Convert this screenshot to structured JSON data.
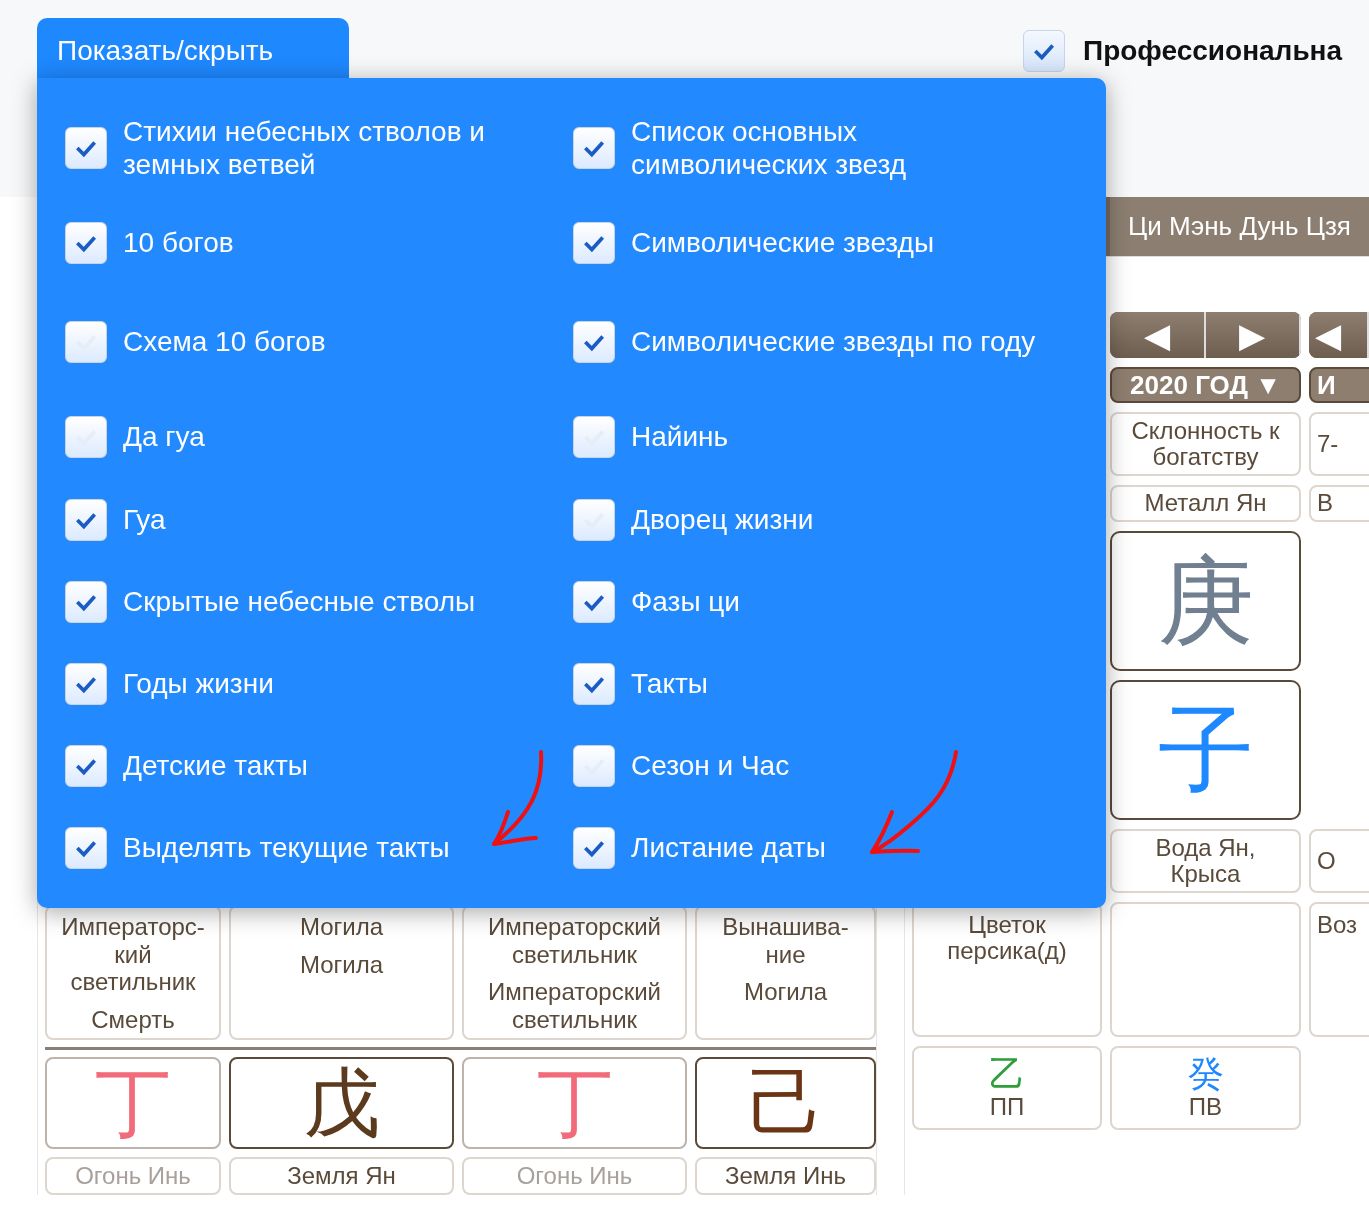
{
  "toggle_button": {
    "label": "Показать/скрыть",
    "expanded": true
  },
  "professional_mode": {
    "label": "Профессиональна",
    "checked": true
  },
  "options": [
    {
      "label": "Стихии небесных стволов и земных ветвей",
      "checked": true
    },
    {
      "label": "Список основных символических звезд",
      "checked": true
    },
    {
      "label": "10 богов",
      "checked": true
    },
    {
      "label": "Символические звезды",
      "checked": true
    },
    {
      "label": "Схема 10 богов",
      "checked": false
    },
    {
      "label": "Символические звезды по году",
      "checked": true
    },
    {
      "label": "Да гуа",
      "checked": false
    },
    {
      "label": "Найинь",
      "checked": false
    },
    {
      "label": "Гуа",
      "checked": true
    },
    {
      "label": "Дворец жизни",
      "checked": false
    },
    {
      "label": "Скрытые небесные стволы",
      "checked": true
    },
    {
      "label": "Фазы ци",
      "checked": true
    },
    {
      "label": "Годы жизни",
      "checked": true
    },
    {
      "label": "Такты",
      "checked": true
    },
    {
      "label": "Детские такты",
      "checked": true
    },
    {
      "label": "Сезон и Час",
      "checked": false
    },
    {
      "label": "Выделять текущие такты",
      "checked": true
    },
    {
      "label": "Листание даты",
      "checked": true
    }
  ],
  "tabs": [
    {
      "label": "Ци Мэнь Дунь Цзя",
      "selected": false
    }
  ],
  "right_grid": [
    {
      "stars": "Цветок персика(д)",
      "hidden_stem": {
        "char": "乙",
        "color": "#2e9e3a",
        "label": "ПП"
      }
    },
    {
      "nav": [
        "◀",
        "▶"
      ],
      "period": "2020 ГОД ▼",
      "star": "Склонность к богатству",
      "element": "Металл Ян",
      "stem": {
        "char": "庚",
        "color": "#708090"
      },
      "branch": {
        "char": "子",
        "color": "#1e88ff"
      },
      "description": "Вода Ян, Крыса",
      "hidden_stem": {
        "char": "癸",
        "color": "#1e88ff",
        "label": "ПВ"
      }
    },
    {
      "nav": [
        "◀"
      ],
      "period": "И",
      "star": "7-",
      "element": "В",
      "description": "О",
      "stars": "Воз"
    }
  ],
  "left_grid": [
    {
      "stars": [
        "Императорс-\nкий\nсветильник",
        "Смерть"
      ],
      "stem": {
        "char": "丁",
        "color": "#f26b7a"
      },
      "element": "Огонь Инь",
      "dimmed": true
    },
    {
      "stars": [
        "Могила",
        "Могила"
      ],
      "stem": {
        "char": "戊",
        "color": "#5c3a1e"
      },
      "element": "Земля Ян",
      "dimmed": false
    },
    {
      "stars": [
        "Императорский светильник",
        "Императорский светильник"
      ],
      "stem": {
        "char": "丁",
        "color": "#f26b7a"
      },
      "element": "Огонь Инь",
      "dimmed": true
    },
    {
      "stars": [
        "Вынашива-\nние",
        "Могила"
      ],
      "stem": {
        "char": "己",
        "color": "#6b3515"
      },
      "element": "Земля Инь",
      "dimmed": false
    }
  ]
}
